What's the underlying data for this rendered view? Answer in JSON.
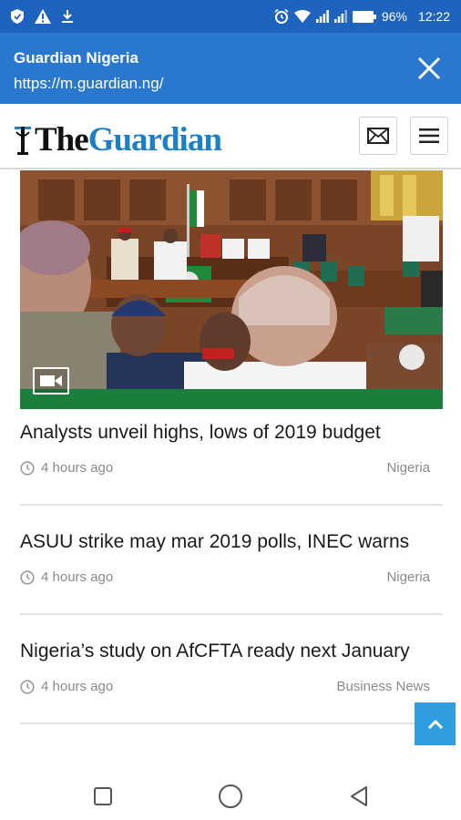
{
  "status_bar": {
    "battery": "96%",
    "time": "12:22",
    "icons": [
      "shield-icon",
      "warning-icon",
      "download-icon",
      "alarm-icon",
      "wifi-icon",
      "signal-icon",
      "signal-icon",
      "battery-icon"
    ]
  },
  "tab": {
    "title": "Guardian Nigeria",
    "url": "https://m.guardian.ng/"
  },
  "site": {
    "logo_the": "The",
    "logo_guardian": "Guardian",
    "icons": [
      "mail-icon",
      "hamburger-menu-icon"
    ]
  },
  "hero": {
    "media_type": "video-icon"
  },
  "articles": [
    {
      "headline": "Analysts unveil highs, lows of 2019 budget",
      "time": "4 hours ago",
      "section": "Nigeria"
    },
    {
      "headline": "ASUU strike may mar 2019 polls, INEC warns",
      "time": "4 hours ago",
      "section": "Nigeria"
    },
    {
      "headline": "Nigeria’s study on AfCFTA ready next January",
      "time": "4 hours ago",
      "section": "Business News"
    }
  ],
  "colors": {
    "status_bar": "#1e63bd",
    "tab_bar": "#2a77cf",
    "brand_blue": "#1d7fc6",
    "scroll_top_button": "#2f9de0"
  }
}
